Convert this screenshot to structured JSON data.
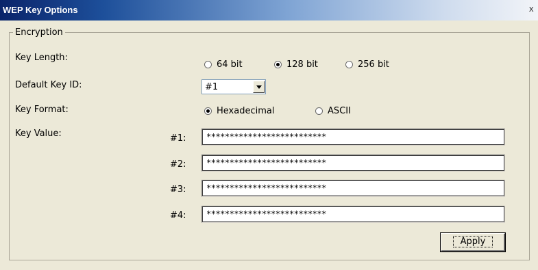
{
  "window": {
    "title": "WEP Key Options",
    "close_label": "x"
  },
  "encryption": {
    "legend": "Encryption",
    "key_length": {
      "label": "Key Length:",
      "options": [
        "64 bit",
        "128 bit",
        "256 bit"
      ],
      "selected": "128 bit"
    },
    "default_key_id": {
      "label": "Default Key ID:",
      "value": "#1"
    },
    "key_format": {
      "label": "Key Format:",
      "options": [
        "Hexadecimal",
        "ASCII"
      ],
      "selected": "Hexadecimal"
    },
    "key_value": {
      "label": "Key Value:",
      "keys": [
        {
          "label": "#1:",
          "value": "**************************"
        },
        {
          "label": "#2:",
          "value": "**************************"
        },
        {
          "label": "#3:",
          "value": "**************************"
        },
        {
          "label": "#4:",
          "value": "**************************"
        }
      ]
    }
  },
  "actions": {
    "apply_label": "Apply"
  },
  "colors": {
    "dialog_bg": "#ece9d8",
    "title_bar_start": "#0a246a",
    "title_bar_end": "#f2f4f8",
    "input_border": "#7f9db9"
  }
}
